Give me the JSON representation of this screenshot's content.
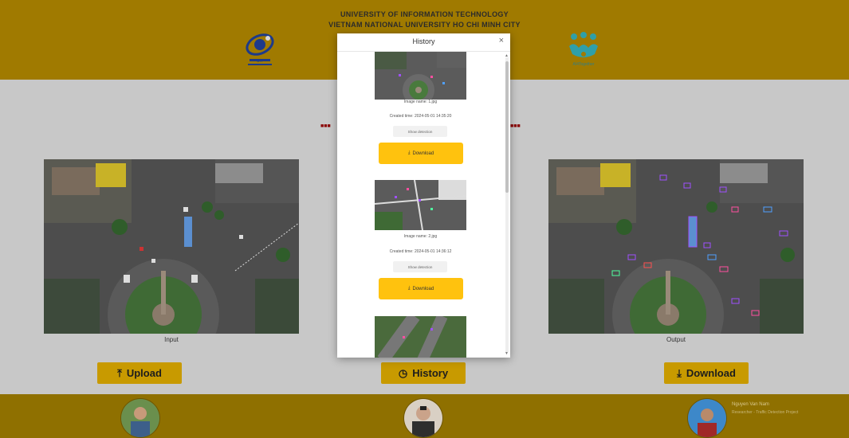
{
  "header": {
    "title_line1": "UNIVERSITY OF INFORMATION TECHNOLOGY",
    "title_line2": "VIETNAM NATIONAL UNIVERSITY HO CHI MINH CITY",
    "logo_left_caption": "UIT",
    "logo_right_caption": "AI4Together"
  },
  "main": {
    "input_label": "Input",
    "output_label": "Output",
    "upload_label": "Upload",
    "history_label": "History",
    "download_label": "Download"
  },
  "modal": {
    "title": "History",
    "close": "×",
    "items": [
      {
        "name": "Image name: 1.jpg",
        "time": "Created time: 2024-05-01 14:35:20",
        "chip": "Show detection",
        "download": "Download"
      },
      {
        "name": "Image name: 2.jpg",
        "time": "Created time: 2024-05-01 14:36:12",
        "chip": "Show detection",
        "download": "Download"
      }
    ]
  },
  "footer": {
    "name": "Nguyen Van Nam",
    "role": "Researcher - Traffic Detection Project"
  },
  "colors": {
    "header_bg": "#a07a00",
    "footer_bg": "#8f7000",
    "button_bg": "#c89a00",
    "modal_button": "#ffc20e"
  }
}
